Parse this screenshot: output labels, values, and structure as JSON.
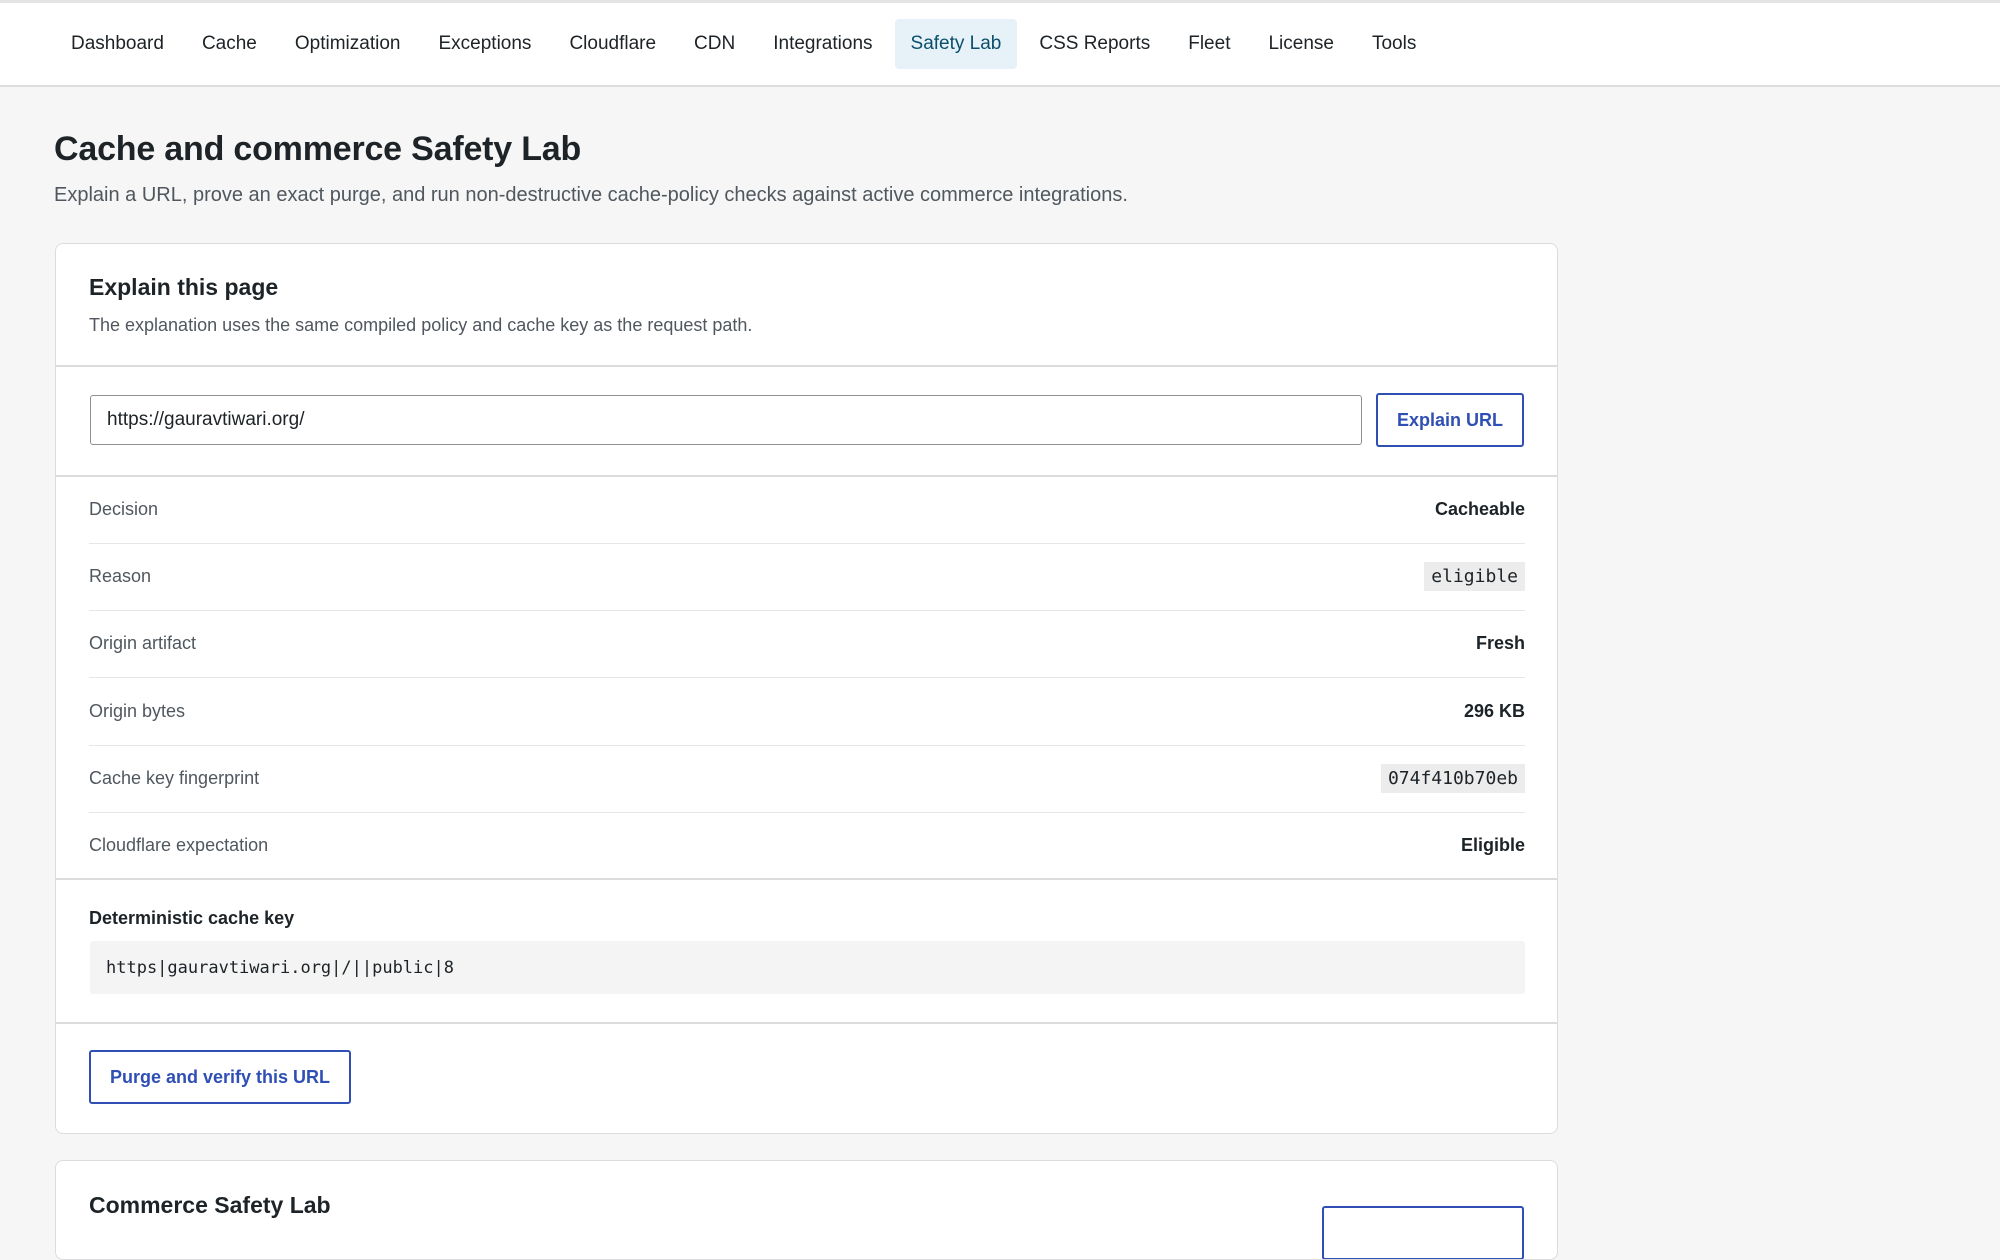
{
  "nav": {
    "tabs": [
      {
        "label": "Dashboard"
      },
      {
        "label": "Cache"
      },
      {
        "label": "Optimization"
      },
      {
        "label": "Exceptions"
      },
      {
        "label": "Cloudflare"
      },
      {
        "label": "CDN"
      },
      {
        "label": "Integrations"
      },
      {
        "label": "Safety Lab",
        "active": true
      },
      {
        "label": "CSS Reports"
      },
      {
        "label": "Fleet"
      },
      {
        "label": "License"
      },
      {
        "label": "Tools"
      }
    ]
  },
  "page": {
    "title": "Cache and commerce Safety Lab",
    "description": "Explain a URL, prove an exact purge, and run non-destructive cache-policy checks against active commerce integrations."
  },
  "explain": {
    "title": "Explain this page",
    "subtitle": "The explanation uses the same compiled policy and cache key as the request path.",
    "url_value": "https://gauravtiwari.org/",
    "explain_button": "Explain URL",
    "rows": [
      {
        "label": "Decision",
        "value": "Cacheable"
      },
      {
        "label": "Reason",
        "value": "eligible"
      },
      {
        "label": "Origin artifact",
        "value": "Fresh"
      },
      {
        "label": "Origin bytes",
        "value": "296 KB"
      },
      {
        "label": "Cache key fingerprint",
        "value": "074f410b70eb"
      },
      {
        "label": "Cloudflare expectation",
        "value": "Eligible"
      }
    ],
    "cache_key_title": "Deterministic cache key",
    "cache_key_value": "https|gauravtiwari.org|/||public|8",
    "purge_button": "Purge and verify this URL"
  },
  "commerce": {
    "title": "Commerce Safety Lab"
  },
  "colors": {
    "accent": "#2f4fb5",
    "active_tab_bg": "#e6f2f8",
    "page_bg": "#f5f6f5"
  }
}
